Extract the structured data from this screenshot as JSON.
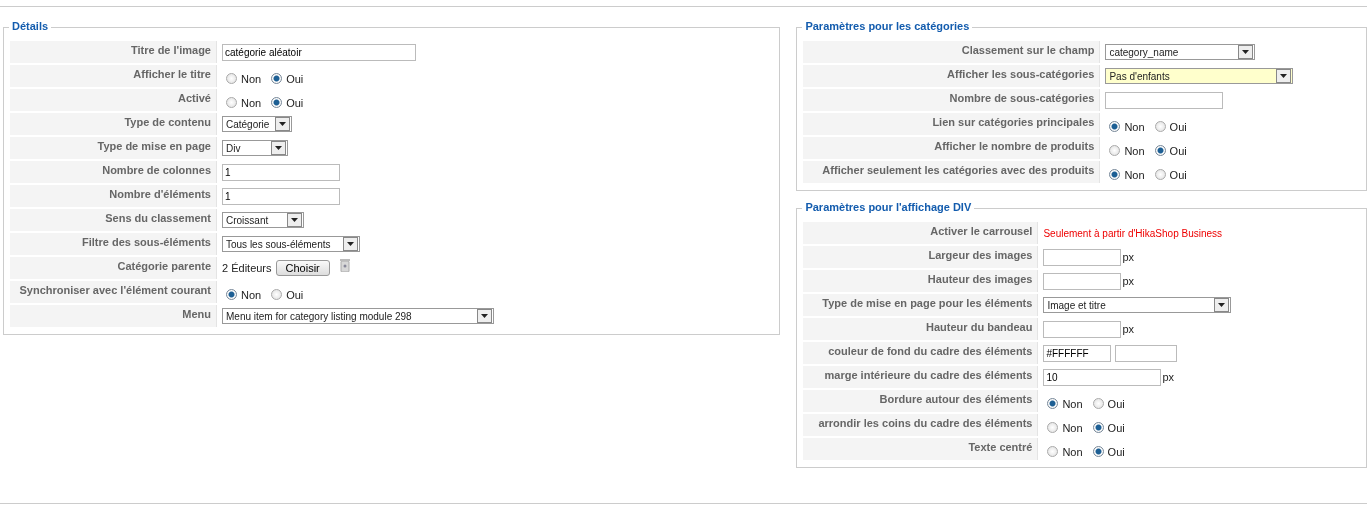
{
  "panels": [
    {
      "title": "Détails",
      "rows": [
        {
          "label": "Titre de l'image",
          "kind": "text",
          "value": "catégorie aléatoir"
        },
        {
          "label": "Afficher le titre",
          "kind": "radio",
          "options": [
            {
              "label": "Non",
              "selected": false
            },
            {
              "label": "Oui",
              "selected": true
            }
          ]
        },
        {
          "label": "Activé",
          "kind": "radio",
          "options": [
            {
              "label": "Non",
              "selected": false
            },
            {
              "label": "Oui",
              "selected": true
            }
          ]
        },
        {
          "label": "Type de contenu",
          "kind": "select",
          "value": "Catégorie",
          "highlighted": false
        },
        {
          "label": "Type de mise en page",
          "kind": "select",
          "value": "Div",
          "highlighted": false
        },
        {
          "label": "Nombre de colonnes",
          "kind": "text",
          "value": "1"
        },
        {
          "label": "Nombre d'éléments",
          "kind": "text",
          "value": "1"
        },
        {
          "label": "Sens du classement",
          "kind": "select",
          "value": "Croissant",
          "highlighted": false
        },
        {
          "label": "Filtre des sous-éléments",
          "kind": "select",
          "value": "Tous les sous-éléments",
          "highlighted": false
        },
        {
          "label": "Catégorie parente",
          "kind": "picker",
          "value": "2 Éditeurs",
          "button": "Choisir"
        },
        {
          "label": "Synchroniser avec l'élément courant",
          "kind": "radio",
          "options": [
            {
              "label": "Non",
              "selected": true
            },
            {
              "label": "Oui",
              "selected": false
            }
          ]
        },
        {
          "label": "Menu",
          "kind": "select",
          "value": "Menu item for category listing module 298",
          "highlighted": false
        }
      ]
    },
    {
      "title": "Paramètres pour les catégories",
      "rows": [
        {
          "label": "Classement sur le champ",
          "kind": "select",
          "value": "category_name",
          "highlighted": false
        },
        {
          "label": "Afficher les sous-catégories",
          "kind": "select",
          "value": "Pas d'enfants",
          "highlighted": true
        },
        {
          "label": "Nombre de sous-catégories",
          "kind": "text",
          "value": ""
        },
        {
          "label": "Lien sur catégories principales",
          "kind": "radio",
          "options": [
            {
              "label": "Non",
              "selected": true
            },
            {
              "label": "Oui",
              "selected": false
            }
          ]
        },
        {
          "label": "Afficher le nombre de produits",
          "kind": "radio",
          "options": [
            {
              "label": "Non",
              "selected": false
            },
            {
              "label": "Oui",
              "selected": true
            }
          ]
        },
        {
          "label": "Afficher seulement les catégories avec des produits",
          "kind": "radio",
          "options": [
            {
              "label": "Non",
              "selected": true
            },
            {
              "label": "Oui",
              "selected": false
            }
          ]
        }
      ]
    },
    {
      "title": "Paramètres pour l'affichage DIV",
      "rows": [
        {
          "label": "Activer le carrousel",
          "kind": "note",
          "value": "Seulement à partir d'HikaShop Business"
        },
        {
          "label": "Largeur des images",
          "kind": "text",
          "value": "",
          "unit": "px"
        },
        {
          "label": "Hauteur des images",
          "kind": "text",
          "value": "",
          "unit": "px"
        },
        {
          "label": "Type de mise en page pour les éléments",
          "kind": "select",
          "value": "Image et titre",
          "highlighted": false
        },
        {
          "label": "Hauteur du bandeau",
          "kind": "text",
          "value": "",
          "unit": "px"
        },
        {
          "label": "couleur de fond du cadre des éléments",
          "kind": "color",
          "value": "#FFFFFF"
        },
        {
          "label": "marge intérieure du cadre des éléments",
          "kind": "text",
          "value": "10",
          "unit": "px"
        },
        {
          "label": "Bordure autour des éléments",
          "kind": "radio",
          "options": [
            {
              "label": "Non",
              "selected": true
            },
            {
              "label": "Oui",
              "selected": false
            }
          ]
        },
        {
          "label": "arrondir les coins du cadre des éléments",
          "kind": "radio",
          "options": [
            {
              "label": "Non",
              "selected": false
            },
            {
              "label": "Oui",
              "selected": true
            }
          ]
        },
        {
          "label": "Texte centré",
          "kind": "radio",
          "options": [
            {
              "label": "Non",
              "selected": false
            },
            {
              "label": "Oui",
              "selected": true
            }
          ]
        }
      ]
    }
  ]
}
